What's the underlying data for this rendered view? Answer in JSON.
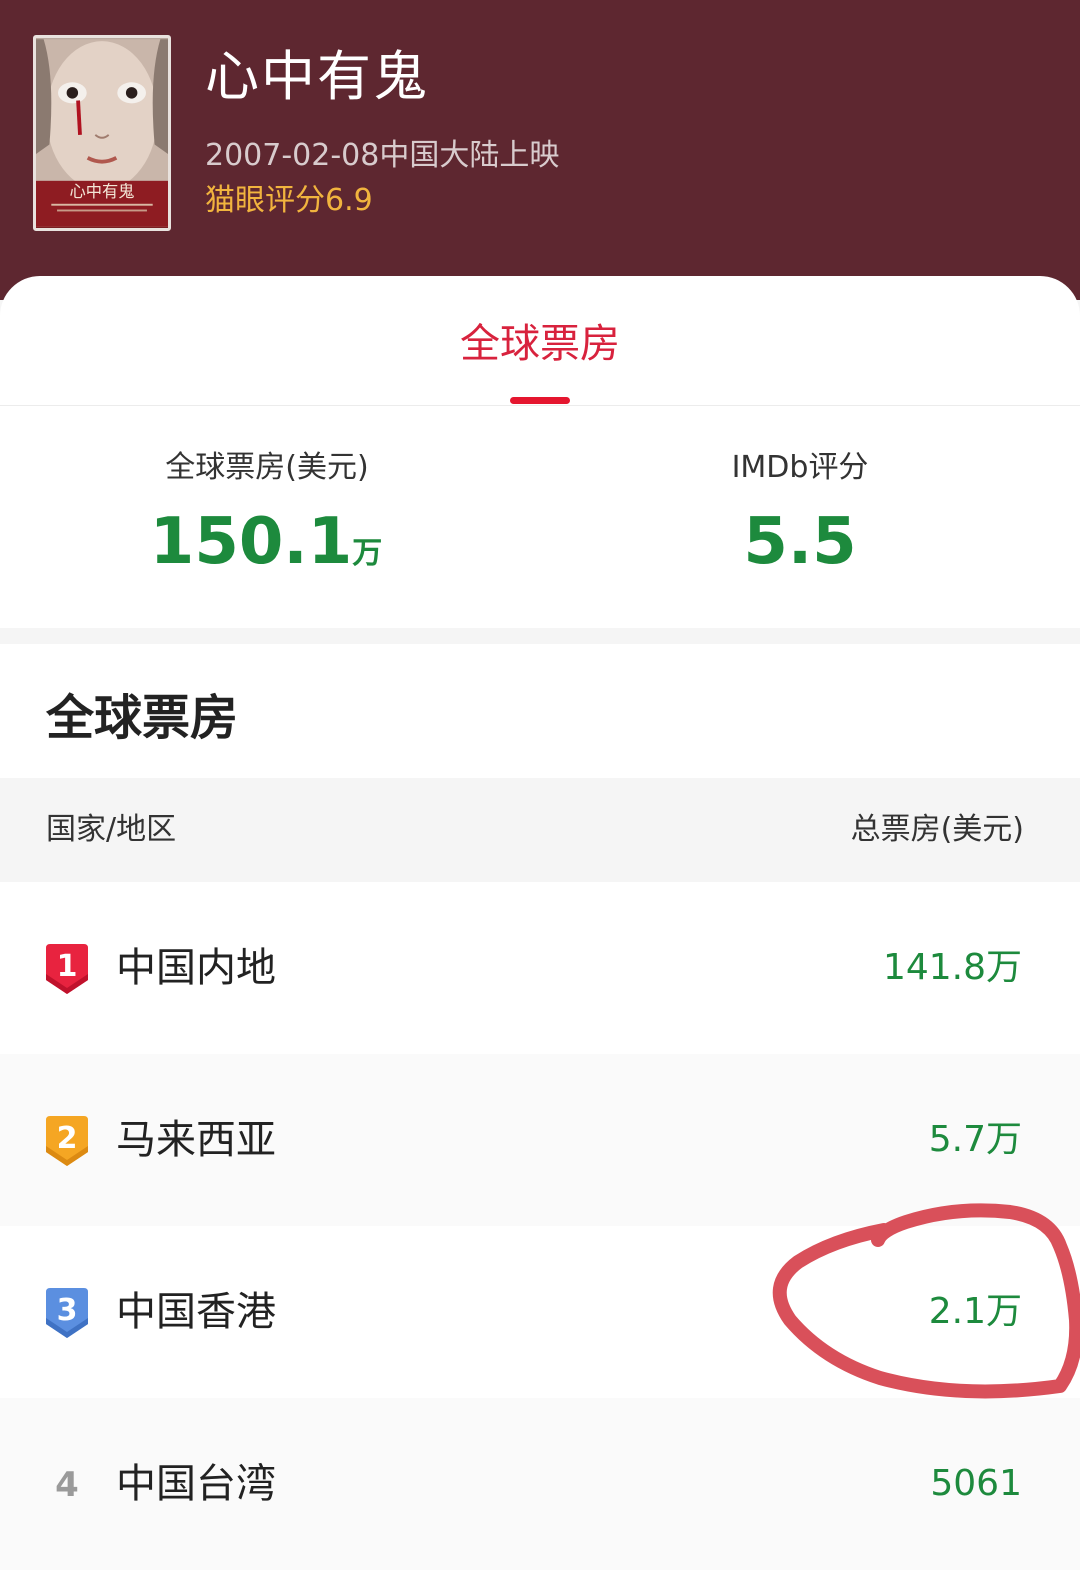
{
  "movie": {
    "title": "心中有鬼",
    "release": "2007-02-08中国大陆上映",
    "maoyan_score": "猫眼评分6.9"
  },
  "tab": {
    "label": "全球票房"
  },
  "stats": {
    "global_label": "全球票房(美元)",
    "global_value": "150.1",
    "global_unit": "万",
    "imdb_label": "IMDb评分",
    "imdb_value": "5.5"
  },
  "section": {
    "title": "全球票房",
    "col_region": "国家/地区",
    "col_total": "总票房(美元)"
  },
  "rows": [
    {
      "rank": "1",
      "region": "中国内地",
      "amount": "141.8万"
    },
    {
      "rank": "2",
      "region": "马来西亚",
      "amount": "5.7万"
    },
    {
      "rank": "3",
      "region": "中国香港",
      "amount": "2.1万"
    },
    {
      "rank": "4",
      "region": "中国台湾",
      "amount": "5061"
    }
  ],
  "colors": {
    "header_bg": "#5e2730",
    "accent_red": "#d8223d",
    "value_green": "#1d8a3d",
    "score_gold": "#f1b43e",
    "rank1": "#e8233f",
    "rank2": "#f5a623",
    "rank3": "#5b8fe0",
    "annotation": "#d9505a"
  }
}
